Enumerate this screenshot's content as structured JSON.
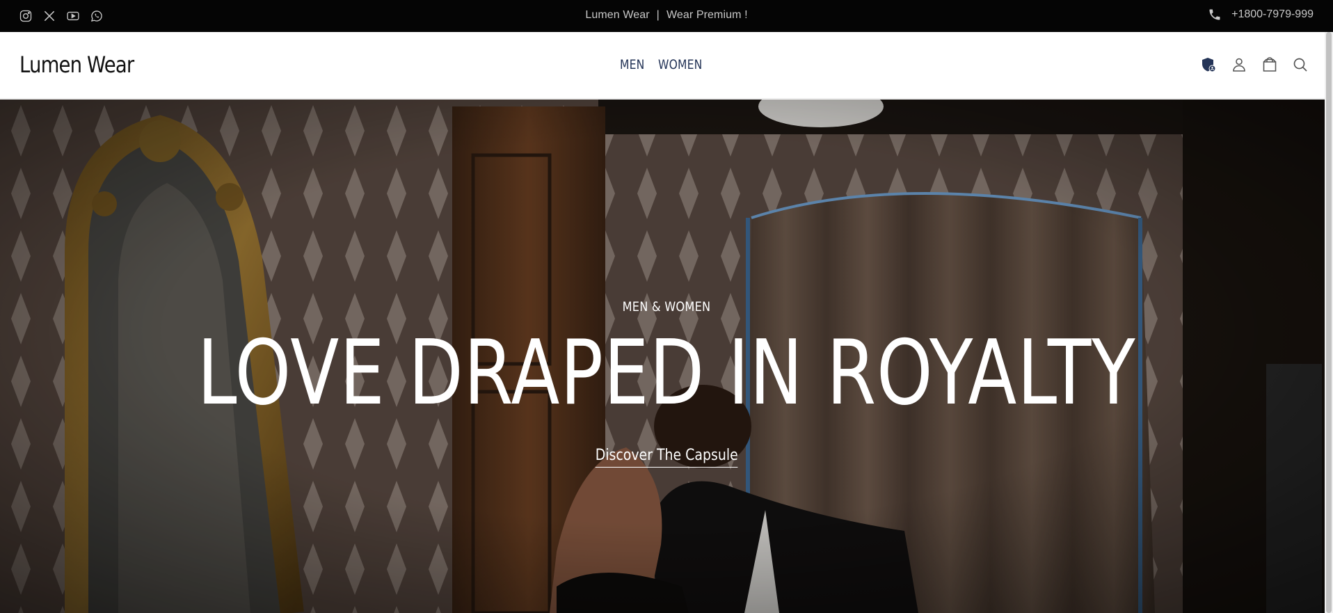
{
  "announcement": {
    "brand": "Lumen Wear",
    "separator": "|",
    "tagline": "Wear Premium !",
    "phone": "+1800-7979-999",
    "social_icons": [
      "instagram-icon",
      "x-icon",
      "youtube-icon",
      "whatsapp-icon"
    ]
  },
  "header": {
    "logo": "Lumen Wear",
    "nav": [
      {
        "label": "MEN"
      },
      {
        "label": "WOMEN"
      }
    ],
    "icons": [
      "shield-account-icon",
      "user-icon",
      "bag-icon",
      "search-icon"
    ]
  },
  "hero": {
    "eyebrow": "MEN & WOMEN",
    "headline": "LOVE DRAPED IN ROYALTY",
    "cta": "Discover The Capsule"
  },
  "colors": {
    "topbar_bg": "#050505",
    "nav_text": "#243457",
    "hero_text": "#ffffff"
  }
}
